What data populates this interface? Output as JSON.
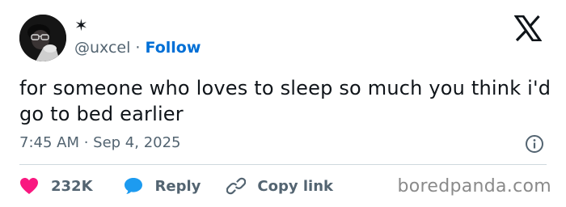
{
  "author": {
    "display_name": "✶",
    "handle": "@uxcel",
    "separator": "·",
    "follow_label": "Follow"
  },
  "tweet": {
    "text": "for someone who loves to sleep so much you think i'd go to bed earlier",
    "timestamp": "7:45 AM · Sep 4, 2025"
  },
  "actions": {
    "like_count": "232K",
    "reply_label": "Reply",
    "copy_link_label": "Copy link"
  },
  "icons": {
    "brand": "x-logo-icon",
    "info": "info-icon",
    "like": "heart-icon",
    "reply": "speech-bubble-icon",
    "copy": "link-icon"
  },
  "colors": {
    "text": "#0f1419",
    "secondary": "#536471",
    "follow": "#006fd6",
    "heart": "#f91880",
    "reply_bubble": "#1d9bf0",
    "divider": "#cfd9de"
  },
  "watermark": "boredpanda.com"
}
